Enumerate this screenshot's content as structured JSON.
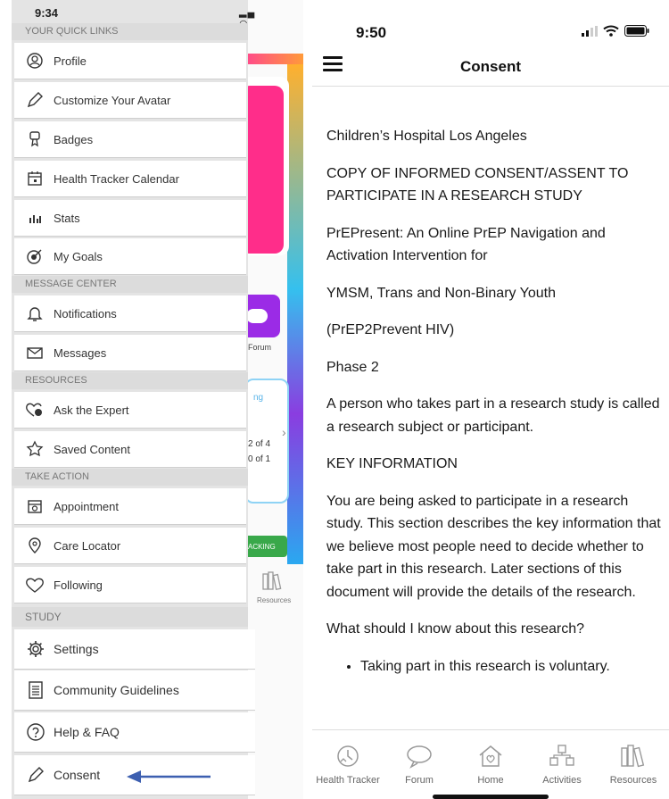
{
  "left": {
    "status": {
      "time": "9:34"
    },
    "sections": [
      {
        "title": "YOUR QUICK LINKS",
        "items": [
          {
            "label": "Profile",
            "icon": "profile-icon"
          },
          {
            "label": "Customize Your Avatar",
            "icon": "pencil-icon"
          },
          {
            "label": "Badges",
            "icon": "badge-icon"
          },
          {
            "label": "Health Tracker Calendar",
            "icon": "calendar-icon"
          },
          {
            "label": "Stats",
            "icon": "stats-icon"
          },
          {
            "label": "My Goals",
            "icon": "target-icon"
          }
        ]
      },
      {
        "title": "MESSAGE CENTER",
        "items": [
          {
            "label": "Notifications",
            "icon": "bell-icon"
          },
          {
            "label": "Messages",
            "icon": "envelope-icon"
          }
        ]
      },
      {
        "title": "RESOURCES",
        "items": [
          {
            "label": "Ask the Expert",
            "icon": "chat-heart-icon"
          },
          {
            "label": "Saved Content",
            "icon": "star-icon"
          }
        ]
      },
      {
        "title": "TAKE ACTION",
        "items": [
          {
            "label": "Appointment",
            "icon": "appointment-icon"
          },
          {
            "label": "Care Locator",
            "icon": "location-pin-icon"
          },
          {
            "label": "Following",
            "icon": "heart-icon"
          }
        ]
      },
      {
        "title": "STUDY",
        "items": [
          {
            "label": "Settings",
            "icon": "gear-icon"
          },
          {
            "label": "Community Guidelines",
            "icon": "document-icon"
          },
          {
            "label": "Help & FAQ",
            "icon": "question-icon"
          },
          {
            "label": "Consent",
            "icon": "pencil-icon"
          }
        ]
      }
    ],
    "peek": {
      "forum_label": "Forum",
      "progress_1": "2 of 4",
      "progress_2": "0 of 1",
      "tracking_label": "ACKING",
      "resources_label": "Resources",
      "fragment": "ng"
    }
  },
  "right": {
    "status": {
      "time": "9:50"
    },
    "title": "Consent",
    "paragraphs": [
      "Children’s Hospital Los Angeles",
      "COPY OF INFORMED CONSENT/ASSENT TO PARTICIPATE IN A RESEARCH STUDY",
      "PrEPresent: An Online PrEP Navigation and Activation Intervention for",
      "YMSM, Trans and Non-Binary Youth",
      "(PrEP2Prevent HIV)",
      "Phase 2",
      "A person who takes part in a research study is called a research subject or participant.",
      "KEY INFORMATION",
      "You are being asked to participate in a research study. This section describes the key information that we believe most people need to decide whether to take part in this research. Later sections of this document will provide the details of the research.",
      "What should I know about this research?"
    ],
    "bullets": [
      "Taking part in this research is voluntary."
    ],
    "tabs": [
      {
        "label": "Health Tracker",
        "icon": "health-tracker-icon"
      },
      {
        "label": "Forum",
        "icon": "speech-bubble-icon"
      },
      {
        "label": "Home",
        "icon": "home-icon"
      },
      {
        "label": "Activities",
        "icon": "activities-icon"
      },
      {
        "label": "Resources",
        "icon": "books-icon"
      }
    ]
  },
  "colors": {
    "arrow": "#3d5fb0",
    "pink": "#ff2d8a",
    "purple": "#9b2be6",
    "green": "#39a84a",
    "blue_edge": "#2aa8f0"
  }
}
